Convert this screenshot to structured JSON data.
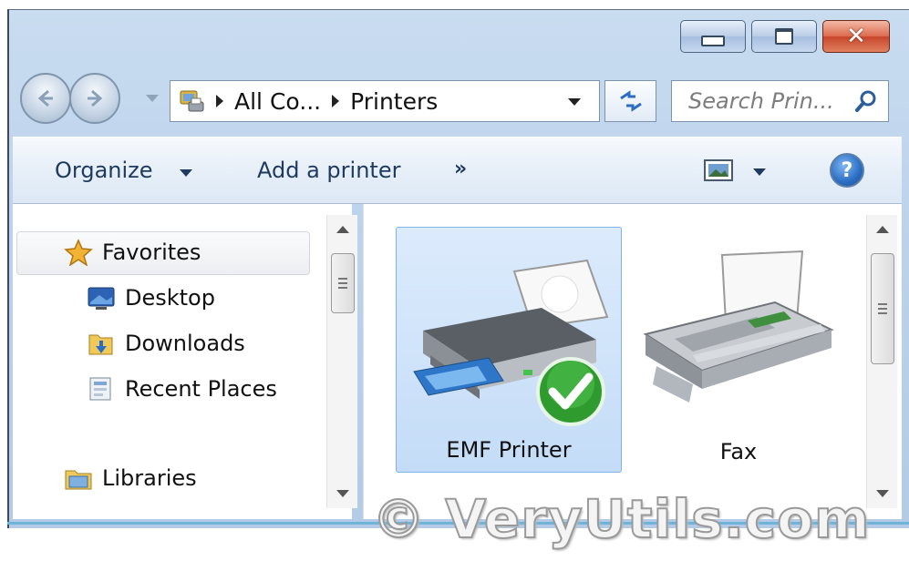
{
  "window": {
    "caption_buttons": {
      "minimize": "",
      "maximize": "",
      "close": "✕"
    }
  },
  "navigation": {
    "breadcrumbs": [
      "All Co...",
      "Printers"
    ],
    "search_placeholder": "Search Prin..."
  },
  "command_bar": {
    "organize_label": "Organize",
    "add_printer_label": "Add a printer",
    "more_label": "»",
    "help_label": "?"
  },
  "nav_pane": {
    "favorites_label": "Favorites",
    "items": [
      {
        "label": "Desktop",
        "icon": "desktop-icon"
      },
      {
        "label": "Downloads",
        "icon": "downloads-folder-icon"
      },
      {
        "label": "Recent Places",
        "icon": "recent-places-icon"
      }
    ],
    "libraries_label": "Libraries"
  },
  "content": {
    "devices": [
      {
        "label": "EMF Printer",
        "icon": "printer-icon",
        "selected": true,
        "default_badge": "check-badge-icon"
      },
      {
        "label": "Fax",
        "icon": "fax-icon",
        "selected": false
      }
    ]
  },
  "watermark": "© VeryUtils.com",
  "colors": {
    "title_gradient_top": "#c9dcf0",
    "close_red": "#c6452a",
    "selection_blue": "#c4dcf7",
    "command_text": "#1e3a5f",
    "bottom_accent": "#6fb3d8"
  }
}
